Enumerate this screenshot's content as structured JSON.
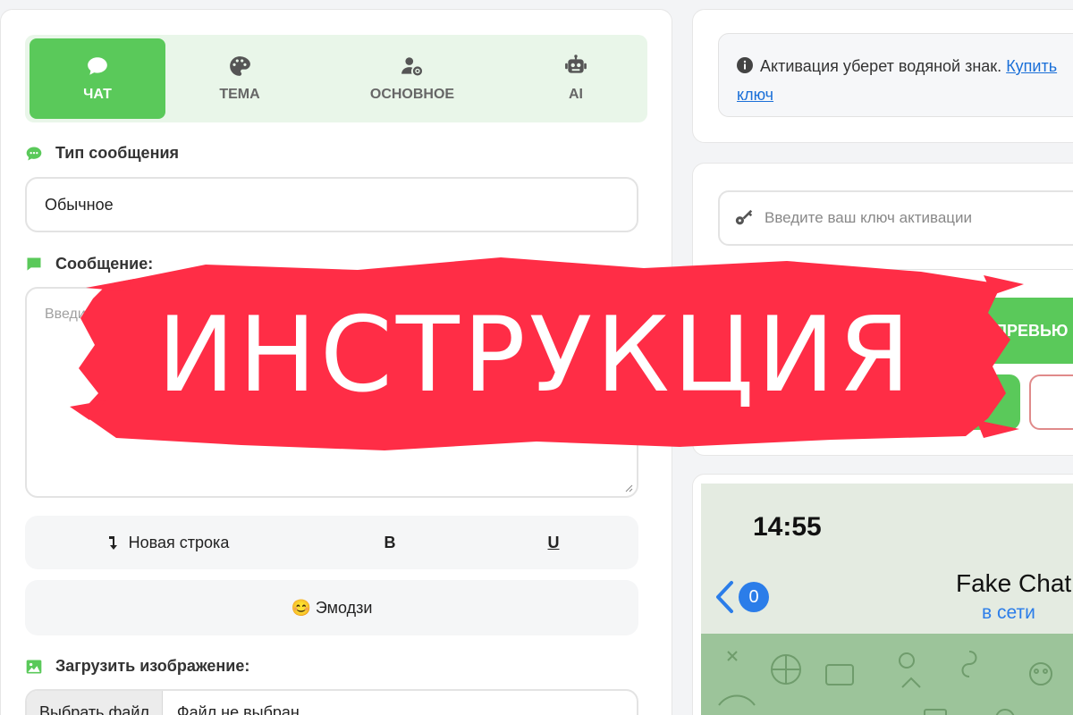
{
  "tabs": [
    {
      "label": "ЧАТ",
      "icon": "chat-bubble-icon",
      "active": true
    },
    {
      "label": "ТЕМА",
      "icon": "palette-icon",
      "active": false
    },
    {
      "label": "ОСНОВНОЕ",
      "icon": "user-gear-icon",
      "active": false
    },
    {
      "label": "AI",
      "icon": "robot-icon",
      "active": false
    }
  ],
  "message_type": {
    "label": "Тип сообщения",
    "value": "Обычное"
  },
  "message": {
    "label": "Сообщение:",
    "placeholder": "Введите текст"
  },
  "formatting": {
    "newline": "Новая строка",
    "bold": "B",
    "underline": "U"
  },
  "emoji_button": "😊 Эмодзи",
  "upload": {
    "label": "Загрузить изображение:",
    "choose_button": "Выбрать файл",
    "no_file": "Файл не выбран"
  },
  "activation": {
    "info_text": "Активация уберет водяной знак.",
    "info_link": "Купить ключ",
    "key_placeholder": "Введите ваш ключ активации",
    "preview_button": "ПРЕВЬЮ"
  },
  "phone_preview": {
    "time": "14:55",
    "unread_count": "0",
    "contact_name": "Fake Chat",
    "status": "в сети"
  },
  "overlay_title": "ИНСТРУКЦИЯ",
  "colors": {
    "accent_green": "#5ac95a",
    "overlay_red": "#ff2d46",
    "link_blue": "#1a6fd8",
    "ios_blue": "#2b7de9"
  }
}
